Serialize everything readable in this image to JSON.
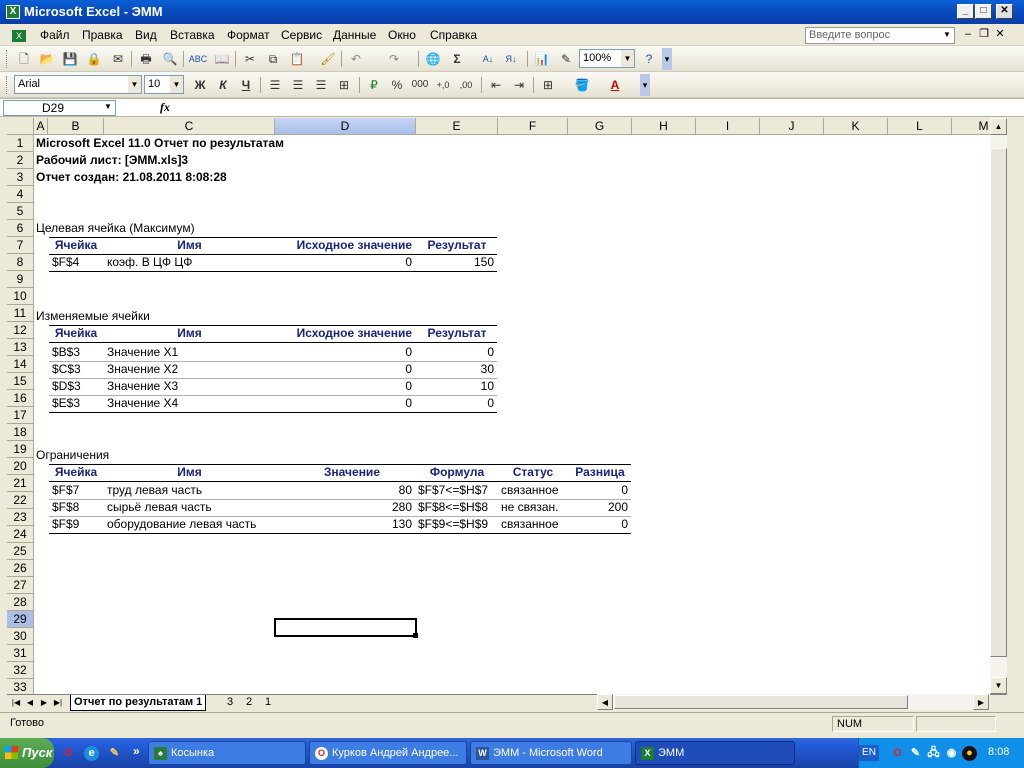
{
  "window": {
    "title": "Microsoft Excel - ЭММ",
    "help_placeholder": "Введите вопрос"
  },
  "menu": [
    "Файл",
    "Правка",
    "Вид",
    "Вставка",
    "Формат",
    "Сервис",
    "Данные",
    "Окно",
    "Справка"
  ],
  "toolbar": {
    "zoom": "100%",
    "font": "Arial",
    "font_size": "10",
    "bold": "Ж",
    "italic": "К",
    "underline": "Ч",
    "percent": "%",
    "thousands": "000"
  },
  "formula_bar": {
    "name_box": "D29",
    "fx": "fx",
    "formula": ""
  },
  "columns": [
    "A",
    "B",
    "C",
    "D",
    "E",
    "F",
    "G",
    "H",
    "I",
    "J",
    "K",
    "L",
    "M"
  ],
  "rows": [
    "1",
    "2",
    "3",
    "4",
    "5",
    "6",
    "7",
    "8",
    "9",
    "10",
    "11",
    "12",
    "13",
    "14",
    "15",
    "16",
    "17",
    "18",
    "19",
    "20",
    "21",
    "22",
    "23",
    "24",
    "25",
    "26",
    "27",
    "28",
    "29",
    "30",
    "31",
    "32",
    "33"
  ],
  "report": {
    "title": "Microsoft Excel 11.0 Отчет по результатам",
    "sheet": "Рабочий лист: [ЭММ.xls]3",
    "created": "Отчет создан: 21.08.2011 8:08:28",
    "target": {
      "caption": "Целевая ячейка (Максимум)",
      "headers": [
        "Ячейка",
        "Имя",
        "Исходное значение",
        "Результат"
      ],
      "rows": [
        {
          "cell": "$F$4",
          "name": "коэф. В ЦФ ЦФ",
          "initial": "0",
          "result": "150"
        }
      ]
    },
    "changing": {
      "caption": "Изменяемые ячейки",
      "headers": [
        "Ячейка",
        "Имя",
        "Исходное значение",
        "Результат"
      ],
      "rows": [
        {
          "cell": "$B$3",
          "name": "Значение X1",
          "initial": "0",
          "result": "0"
        },
        {
          "cell": "$C$3",
          "name": "Значение X2",
          "initial": "0",
          "result": "30"
        },
        {
          "cell": "$D$3",
          "name": "Значение X3",
          "initial": "0",
          "result": "10"
        },
        {
          "cell": "$E$3",
          "name": "Значение X4",
          "initial": "0",
          "result": "0"
        }
      ]
    },
    "constraints": {
      "caption": "Ограничения",
      "headers": [
        "Ячейка",
        "Имя",
        "Значение",
        "Формула",
        "Статус",
        "Разница"
      ],
      "rows": [
        {
          "cell": "$F$7",
          "name": "труд левая часть",
          "value": "80",
          "formula": "$F$7<=$H$7",
          "status": "связанное",
          "diff": "0"
        },
        {
          "cell": "$F$8",
          "name": "сырьё левая часть",
          "value": "280",
          "formula": "$F$8<=$H$8",
          "status": "не связан.",
          "diff": "200"
        },
        {
          "cell": "$F$9",
          "name": "оборудование левая часть",
          "value": "130",
          "formula": "$F$9<=$H$9",
          "status": "связанное",
          "diff": "0"
        }
      ]
    }
  },
  "sheet_tabs": [
    "Отчет по результатам 1",
    "3",
    "2",
    "1"
  ],
  "status": {
    "ready": "Готово",
    "num": "NUM"
  },
  "taskbar": {
    "start": "Пуск",
    "tasks": [
      "Косынка",
      "Курков Андрей Андрее...",
      "ЭММ - Microsoft Word",
      "ЭММ"
    ],
    "lang": "EN",
    "time": "8:08"
  },
  "colors": {
    "header_text": "#1a237e",
    "title_bar": "#0a5fd6",
    "taskbar": "#245edb"
  }
}
